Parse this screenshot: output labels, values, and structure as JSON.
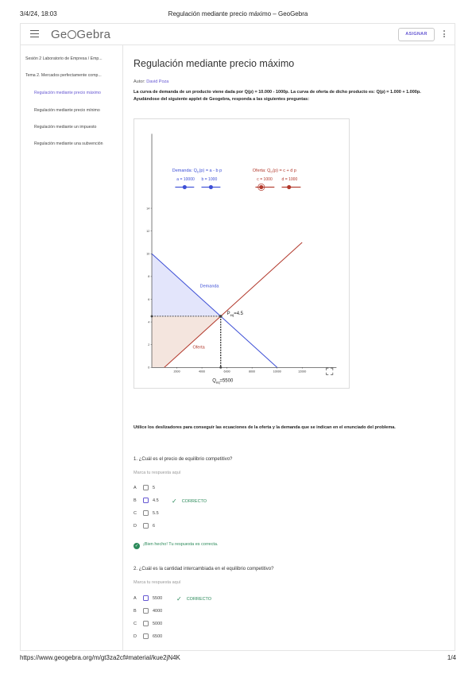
{
  "print_header": {
    "date": "3/4/24, 18:03",
    "title": "Regulación mediante precio máximo – GeoGebra"
  },
  "print_footer": {
    "url": "https://www.geogebra.org/m/gt3za2cf#material/kue2jN4K",
    "page": "1/4"
  },
  "topbar": {
    "logo_pre": "Ge",
    "logo_post": "Gebra",
    "assign_button": "ASIGNAR"
  },
  "sidebar": {
    "items": [
      {
        "label": "Sesión 2 Laboratorio de Empresa / Emp...",
        "active": false
      },
      {
        "label": "Tema 2. Mercados perfectamente comp...",
        "active": false
      },
      {
        "label": "Regulación mediante precio máximo",
        "active": true
      },
      {
        "label": "Regulación mediante precio mínimo",
        "active": false
      },
      {
        "label": "Regulación mediante un impuesto",
        "active": false
      },
      {
        "label": "Regulación mediante una subvención",
        "active": false
      }
    ]
  },
  "main": {
    "title": "Regulación mediante precio máximo",
    "author_label": "Autor:",
    "author_name": "David Poza",
    "intro": "La curva de demanda de un producto viene dada por Q(p) = 10.000 - 1000p. La curva de oferta de dicho producto es: Q(p) = 1.000 + 1.000p. Ayudándose del siguiente applet de Geogebra, responda a las siguientes preguntas:",
    "instructions": "Utilice los deslizadores para conseguir las ecuaciones de la oferta y la demanda que se indican en el enunciado del problema."
  },
  "applet": {
    "demand_eq": "Demanda: Q",
    "demand_eq_sub": "D",
    "demand_eq_tail": "(p) = a - b p",
    "supply_eq": "Oferta: Q",
    "supply_eq_sub": "O",
    "supply_eq_tail": "(p) = c + d p",
    "slider_a": "a = 10000",
    "slider_b": "b = 1000",
    "slider_c": "c = 1000",
    "slider_d": "d = 1000",
    "demand_label": "Demanda",
    "supply_label": "Oferta",
    "p_eq_label": "P",
    "p_eq_sub": "eq",
    "p_eq_value": "=4.5",
    "q_eq_label": "Q",
    "q_eq_sub": "eq",
    "q_eq_value": "=5500",
    "y_ticks": [
      "14",
      "12",
      "10",
      "8",
      "6",
      "4",
      "2",
      "0"
    ],
    "x_ticks": [
      "2000",
      "4000",
      "6000",
      "8000",
      "10000",
      "12000"
    ],
    "colors": {
      "demand": "#3d4fd6",
      "supply": "#b2382b",
      "demand_fill": "#e3e5fb",
      "supply_fill": "#f4e5de"
    }
  },
  "chart_data": {
    "type": "line",
    "series": [
      {
        "name": "Demanda",
        "x": [
          0,
          10000
        ],
        "y": [
          10,
          0
        ]
      },
      {
        "name": "Oferta",
        "x": [
          1000,
          12000
        ],
        "y": [
          0,
          11
        ]
      }
    ],
    "annotations": [
      {
        "text": "Peq=4.5"
      },
      {
        "text": "Qeq=5500"
      }
    ],
    "xlim": [
      0,
      12000
    ],
    "ylim": [
      0,
      14
    ]
  },
  "questions": [
    {
      "text": "1. ¿Cuál es el precio de equilibrio competitivo?",
      "placeholder": "Marca tu respuesta aquí",
      "options": [
        {
          "letter": "A",
          "value": "5",
          "checked": false,
          "correct": ""
        },
        {
          "letter": "B",
          "value": "4.5",
          "checked": true,
          "correct": "CORRECTO"
        },
        {
          "letter": "C",
          "value": "5.5",
          "checked": false,
          "correct": ""
        },
        {
          "letter": "D",
          "value": "6",
          "checked": false,
          "correct": ""
        }
      ],
      "feedback": "¡Bien hecho! Tu respuesta es correcta."
    },
    {
      "text": "2. ¿Cuál es la cantidad intercambiada en el equilibrio competitivo?",
      "placeholder": "Marca tu respuesta aquí",
      "options": [
        {
          "letter": "A",
          "value": "5500",
          "checked": true,
          "correct": "CORRECTO"
        },
        {
          "letter": "B",
          "value": "4000",
          "checked": false,
          "correct": ""
        },
        {
          "letter": "C",
          "value": "5000",
          "checked": false,
          "correct": ""
        },
        {
          "letter": "D",
          "value": "6500",
          "checked": false,
          "correct": ""
        }
      ]
    }
  ]
}
